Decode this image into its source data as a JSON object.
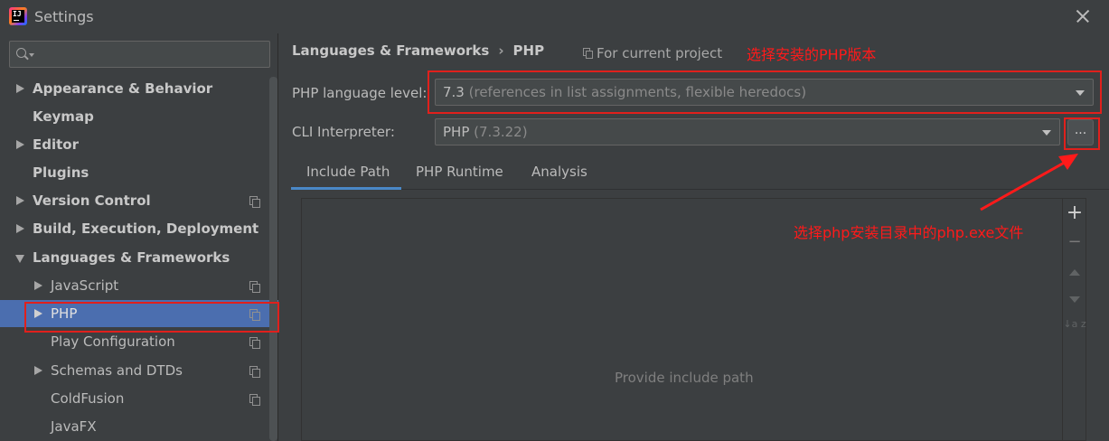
{
  "window": {
    "title": "Settings"
  },
  "search": {
    "placeholder": "",
    "value": ""
  },
  "sidebar": {
    "items": [
      {
        "label": "Appearance & Behavior"
      },
      {
        "label": "Keymap"
      },
      {
        "label": "Editor"
      },
      {
        "label": "Plugins"
      },
      {
        "label": "Version Control"
      },
      {
        "label": "Build, Execution, Deployment"
      },
      {
        "label": "Languages & Frameworks"
      },
      {
        "label": "JavaScript"
      },
      {
        "label": "PHP"
      },
      {
        "label": "Play Configuration"
      },
      {
        "label": "Schemas and DTDs"
      },
      {
        "label": "ColdFusion"
      },
      {
        "label": "JavaFX"
      }
    ],
    "selected": "PHP"
  },
  "header": {
    "breadcrumb": [
      "Languages & Frameworks",
      "PHP"
    ],
    "breadcrumb_sep": "›",
    "scope_label": "For current project"
  },
  "annotations": {
    "top": "选择安装的PHP版本",
    "middle": "选择php安装目录中的php.exe文件"
  },
  "form": {
    "language_level_label": "PHP language level:",
    "language_level_value": "7.3",
    "language_level_desc": "(references in list assignments, flexible heredocs)",
    "cli_label": "CLI Interpreter:",
    "cli_value": "PHP",
    "cli_version": "(7.3.22)",
    "browse_label": "..."
  },
  "tabs": [
    {
      "label": "Include Path",
      "active": true
    },
    {
      "label": "PHP Runtime",
      "active": false
    },
    {
      "label": "Analysis",
      "active": false
    }
  ],
  "include_path": {
    "empty_text": "Provide include path",
    "tools": {
      "add": "+",
      "remove": "−",
      "sort": "↓a z"
    }
  },
  "colors": {
    "background": "#3c3f41",
    "selection": "#4b6eaf",
    "annotation_red": "#ff1a1a",
    "tab_underline": "#4a88c7"
  }
}
